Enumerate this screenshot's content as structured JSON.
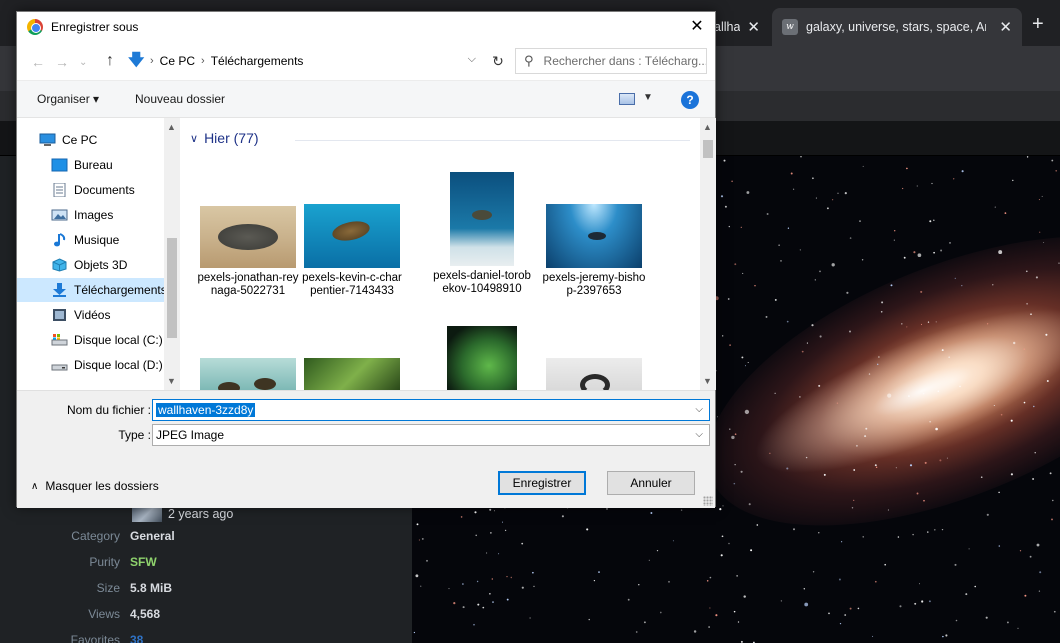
{
  "browser": {
    "tabs": [
      {
        "title": "allha"
      },
      {
        "title": "galaxy, universe, stars, space, Anc",
        "favicon": "w"
      }
    ],
    "new_tab_label": "+"
  },
  "wallpaper_info": {
    "uploaded_ago": "2 years ago",
    "rows": [
      {
        "key": "Category",
        "value": "General",
        "color": "#d8dbe0"
      },
      {
        "key": "Purity",
        "value": "SFW",
        "color": "#8fd36d"
      },
      {
        "key": "Size",
        "value": "5.8 MiB",
        "color": "#d8dbe0"
      },
      {
        "key": "Views",
        "value": "4,568",
        "color": "#d8dbe0"
      },
      {
        "key": "Favorites",
        "value": "38",
        "color": "#2f72c4"
      }
    ]
  },
  "dialog": {
    "title": "Enregistrer sous",
    "close_glyph": "✕",
    "breadcrumb": [
      "Ce PC",
      "Téléchargements"
    ],
    "search_placeholder": "Rechercher dans : Télécharg...",
    "commands": {
      "organize": "Organiser ▾",
      "new_folder": "Nouveau dossier"
    },
    "nav_items": [
      {
        "label": "Ce PC",
        "icon": "computer-icon"
      },
      {
        "label": "Bureau",
        "icon": "desktop-icon"
      },
      {
        "label": "Documents",
        "icon": "documents-icon"
      },
      {
        "label": "Images",
        "icon": "images-icon"
      },
      {
        "label": "Musique",
        "icon": "music-icon"
      },
      {
        "label": "Objets 3D",
        "icon": "objects-3d-icon"
      },
      {
        "label": "Téléchargements",
        "icon": "downloads-icon",
        "selected": true
      },
      {
        "label": "Vidéos",
        "icon": "videos-icon"
      },
      {
        "label": "Disque local (C:)",
        "icon": "drive-c-icon"
      },
      {
        "label": "Disque local (D:)",
        "icon": "drive-d-icon"
      }
    ],
    "group_header": "Hier (77)",
    "files": [
      {
        "name": "pexels-jonathan-reynaga-5022731"
      },
      {
        "name": "pexels-kevin-c-charpentier-7143433"
      },
      {
        "name": "pexels-daniel-torobekov-10498910"
      },
      {
        "name": "pexels-jeremy-bishop-2397653"
      },
      {
        "name": ""
      },
      {
        "name": ""
      },
      {
        "name": ""
      },
      {
        "name": ""
      }
    ],
    "filename_label": "Nom du fichier :",
    "filename_value": "wallhaven-3zzd8y",
    "type_label": "Type :",
    "type_value": "JPEG Image",
    "hide_folders": "Masquer les dossiers",
    "save_button": "Enregistrer",
    "cancel_button": "Annuler"
  },
  "colors": {
    "accent": "#0078d7",
    "selected_nav": "#cce8ff",
    "group_header": "#1e3287"
  }
}
